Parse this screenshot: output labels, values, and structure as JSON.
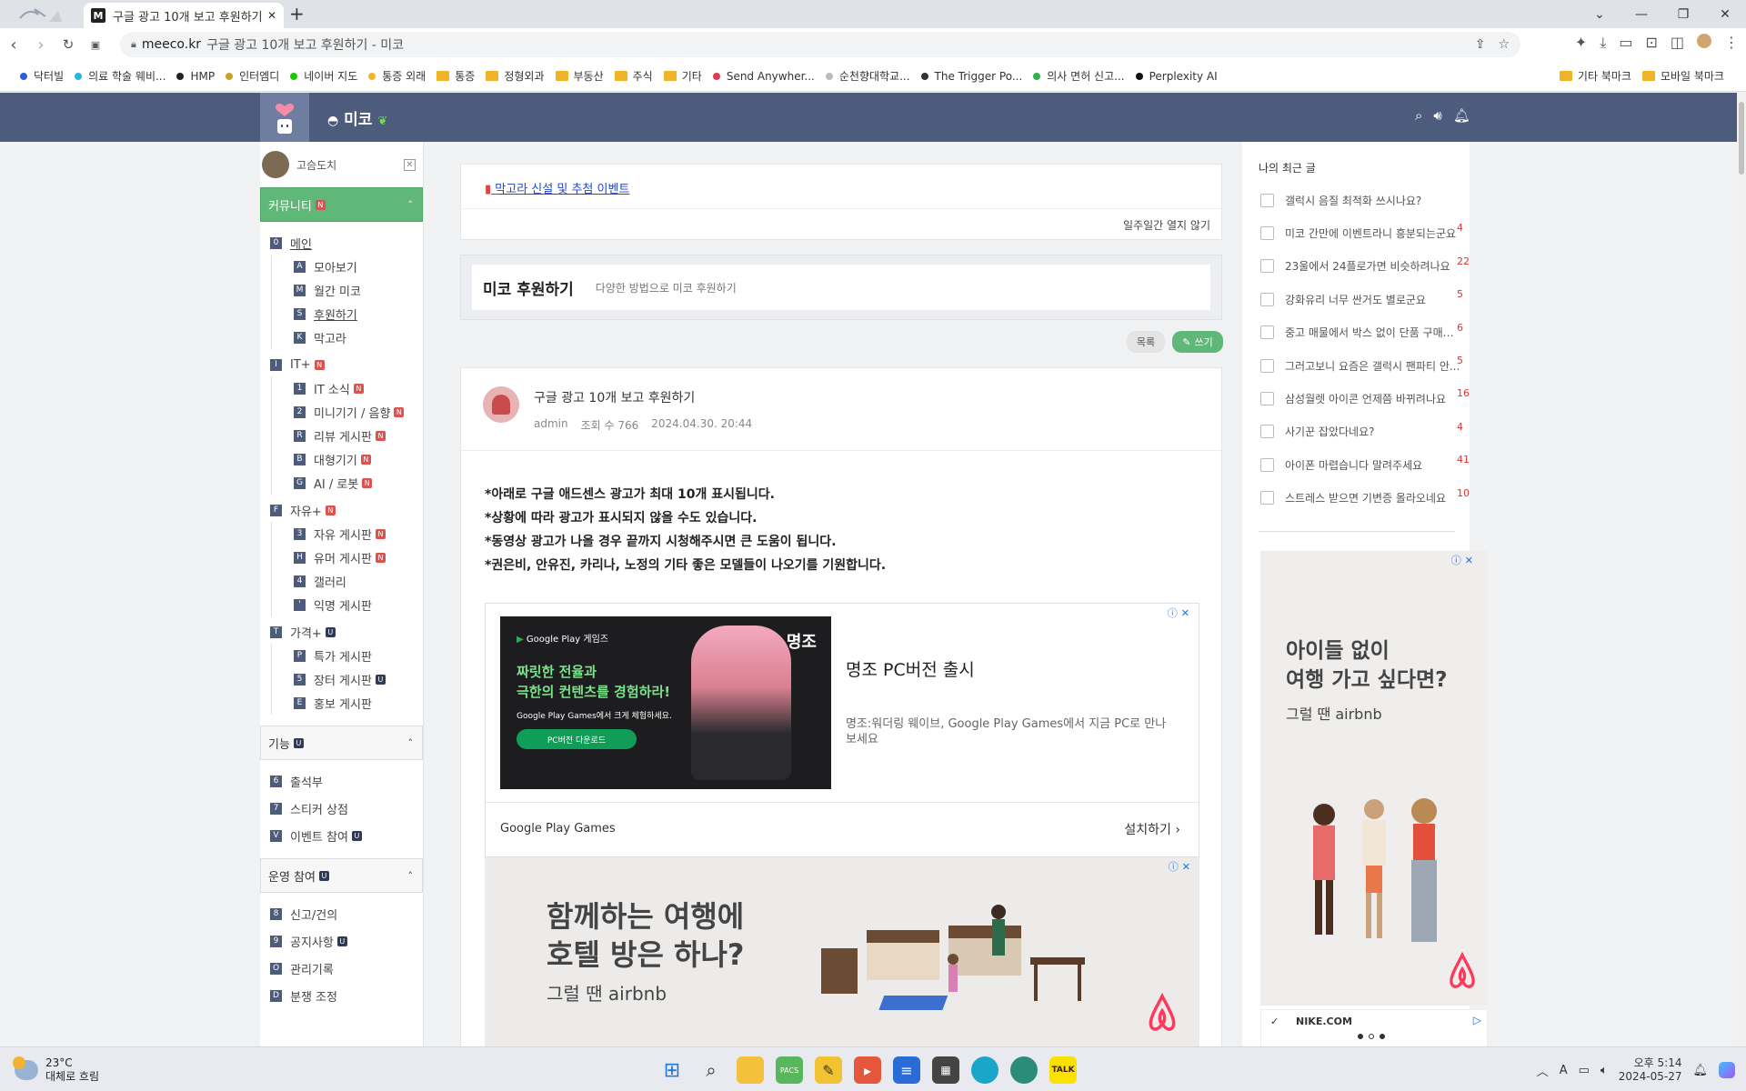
{
  "browser": {
    "tab_title": "구글 광고 10개 보고 후원하기 - 미코",
    "tab_favicon": "M",
    "address_domain": "meeco.kr",
    "address_title": "구글 광고 10개 보고 후원하기 - 미코",
    "bookmarks": [
      {
        "label": "닥터빌",
        "color": "#2b5fd9"
      },
      {
        "label": "의료 학술 웨비...",
        "color": "#29b6d8"
      },
      {
        "label": "HMP",
        "color": "#222222"
      },
      {
        "label": "인터엠디",
        "color": "#c9a227"
      },
      {
        "label": "네이버 지도",
        "color": "#1ec800"
      },
      {
        "label": "통증 외래",
        "color": "#f0b429"
      },
      {
        "label": "통증",
        "folder": true
      },
      {
        "label": "정형외과",
        "folder": true
      },
      {
        "label": "부동산",
        "folder": true
      },
      {
        "label": "주식",
        "folder": true
      },
      {
        "label": "기타",
        "folder": true
      },
      {
        "label": "Send Anywher...",
        "color": "#e63950"
      },
      {
        "label": "순천향대학교...",
        "color": "#bbbbbb"
      },
      {
        "label": "The Trigger Po...",
        "color": "#333333"
      },
      {
        "label": "의사 면허 신고...",
        "color": "#2eb34a"
      },
      {
        "label": "Perplexity AI",
        "color": "#111111"
      }
    ],
    "bookmarks_right": [
      "기타 북마크",
      "모바일 북마크"
    ]
  },
  "site": {
    "name": "미코",
    "sidebar": {
      "username": "고슴도치",
      "sections": [
        {
          "title": "커뮤니티",
          "badge": "N",
          "green": true,
          "items": [
            {
              "icon": "0",
              "label": "메인",
              "level": 0,
              "underline": true
            },
            {
              "icon": "A",
              "label": "모아보기",
              "level": 1
            },
            {
              "icon": "M",
              "label": "월간 미코",
              "level": 1
            },
            {
              "icon": "S",
              "label": "후원하기",
              "level": 1,
              "underline": true
            },
            {
              "icon": "K",
              "label": "막고라",
              "level": 1
            },
            {
              "icon": "I",
              "label": "IT+",
              "level": 0,
              "badge": "N"
            },
            {
              "icon": "1",
              "label": "IT 소식",
              "level": 1,
              "badge": "N"
            },
            {
              "icon": "2",
              "label": "미니기기 / 음향",
              "level": 1,
              "badge": "N"
            },
            {
              "icon": "R",
              "label": "리뷰 게시판",
              "level": 1,
              "badge": "N"
            },
            {
              "icon": "B",
              "label": "대형기기",
              "level": 1,
              "badge": "N"
            },
            {
              "icon": "G",
              "label": "AI / 로봇",
              "level": 1,
              "badge": "N"
            },
            {
              "icon": "F",
              "label": "자유+",
              "level": 0,
              "badge": "N"
            },
            {
              "icon": "3",
              "label": "자유 게시판",
              "level": 1,
              "badge": "N"
            },
            {
              "icon": "H",
              "label": "유머 게시판",
              "level": 1,
              "badge": "N"
            },
            {
              "icon": "4",
              "label": "갤러리",
              "level": 1
            },
            {
              "icon": "'",
              "label": "익명 게시판",
              "level": 1
            },
            {
              "icon": "T",
              "label": "가격+",
              "level": 0,
              "badge": "U"
            },
            {
              "icon": "P",
              "label": "특가 게시판",
              "level": 1
            },
            {
              "icon": "5",
              "label": "장터 게시판",
              "level": 1,
              "badge": "U"
            },
            {
              "icon": "E",
              "label": "홍보 게시판",
              "level": 1
            }
          ]
        },
        {
          "title": "기능",
          "badge": "U",
          "items": [
            {
              "icon": "6",
              "label": "출석부",
              "level": 0
            },
            {
              "icon": "7",
              "label": "스티커 상점",
              "level": 0
            },
            {
              "icon": "V",
              "label": "이벤트 참여",
              "level": 0,
              "badge": "U"
            }
          ]
        },
        {
          "title": "운영 참여",
          "badge": "U",
          "items": [
            {
              "icon": "8",
              "label": "신고/건의",
              "level": 0
            },
            {
              "icon": "9",
              "label": "공지사항",
              "level": 0,
              "badge": "U"
            },
            {
              "icon": "O",
              "label": "관리기록",
              "level": 0
            },
            {
              "icon": "D",
              "label": "분쟁 조정",
              "level": 0
            }
          ]
        }
      ]
    },
    "notice": {
      "link": "막고라 신설 및 추첨 이벤트",
      "hide": "일주일간 열지 않기"
    },
    "board": {
      "title": "미코 후원하기",
      "subtitle": "다양한 방법으로 미코 후원하기",
      "list_button": "목록",
      "write_button": "쓰기"
    },
    "post": {
      "title": "구글 광고 10개 보고 후원하기",
      "author": "admin",
      "views": "조회 수 766",
      "date": "2024.04.30. 20:44",
      "lines": [
        "*아래로 구글 애드센스 광고가 최대 10개 표시됩니다.",
        "*상황에 따라 광고가 표시되지 않을 수도 있습니다.",
        "*동영상 광고가 나올 경우 끝까지 시청해주시면 큰 도움이 됩니다.",
        "*권은비, 안유진, 카리나, 노정의 기타 좋은 모델들이 나오기를 기원합니다."
      ]
    },
    "ad1": {
      "img_brand": "Google Play 게임즈",
      "img_headline_1": "짜릿한 전율과",
      "img_headline_2": "극한의 컨텐츠를 경험하라!",
      "img_sub": "Google Play Games에서 크게 체험하세요.",
      "img_cta": "PC버전 다운로드",
      "img_logo": "명조",
      "title": "명조 PC버전 출시",
      "desc": "명조:워더링 웨이브, Google Play Games에서 지금 PC로 만나보세요",
      "advertiser": "Google Play Games",
      "install": "설치하기"
    },
    "ad2": {
      "line1": "함께하는 여행에",
      "line2": "호텔 방은 하나?",
      "sub": "그럴 땐 airbnb"
    },
    "recent": {
      "heading": "나의 최근 글",
      "items": [
        {
          "title": "갤럭시 음질 최적화 쓰시나요?",
          "count": ""
        },
        {
          "title": "미코 간만에 이벤트라니 흥분되는군요",
          "count": "4"
        },
        {
          "title": "23울에서 24플로가면 비슷하려나요",
          "count": "22"
        },
        {
          "title": "강화유리 너무 싼거도 별로군요",
          "count": "5"
        },
        {
          "title": "중고 매물에서 박스 없이 단품 구매해...",
          "count": "6"
        },
        {
          "title": "그러고보니 요즘은 갤럭시 팬파티 안...",
          "count": "5"
        },
        {
          "title": "삼성월렛 아이콘 언제쯤 바뀌려나요",
          "count": "16"
        },
        {
          "title": "사기꾼 잡았다네요?",
          "count": "4"
        },
        {
          "title": "아이폰 마렵습니다 말려주세요",
          "count": "41"
        },
        {
          "title": "스트레스 받으면 기변증 올라오네요",
          "count": "10"
        }
      ]
    },
    "ad3": {
      "line1": "아이들 없이",
      "line2": "여행 가고 싶다면?",
      "sub": "그럴 땐 airbnb",
      "footer": "NIKE.COM"
    }
  },
  "taskbar": {
    "temp": "23°C",
    "weather": "대체로 흐림",
    "time": "오후 5:14",
    "date": "2024-05-27"
  }
}
